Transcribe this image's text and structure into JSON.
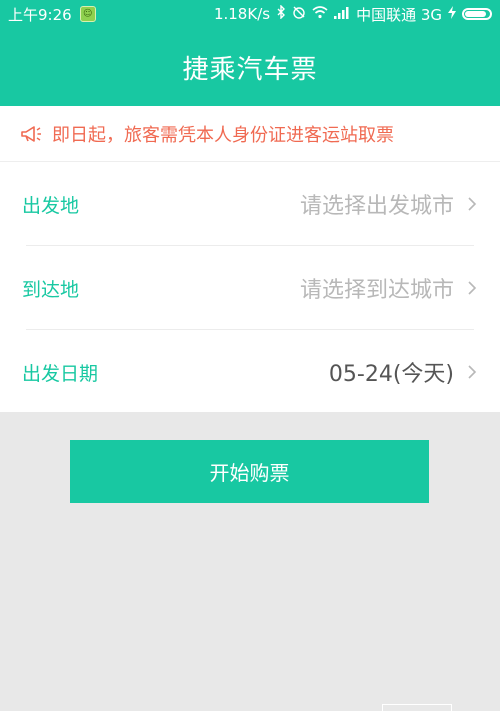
{
  "status_bar": {
    "time": "上午9:26",
    "speed": "1.18K/s",
    "carrier": "中国联通 3G",
    "battery_level": 0.9
  },
  "header": {
    "title": "捷乘汽车票"
  },
  "notice": {
    "text": "即日起，旅客需凭本人身份证进客运站取票",
    "color": "#f06a52"
  },
  "form": {
    "departure": {
      "label": "出发地",
      "placeholder": "请选择出发城市"
    },
    "arrival": {
      "label": "到达地",
      "placeholder": "请选择到达城市"
    },
    "date": {
      "label": "出发日期",
      "value": "05-24(今天)"
    }
  },
  "actions": {
    "buy_label": "开始购票"
  },
  "theme": {
    "accent": "#18c8a2",
    "background": "#e8e8e8"
  }
}
